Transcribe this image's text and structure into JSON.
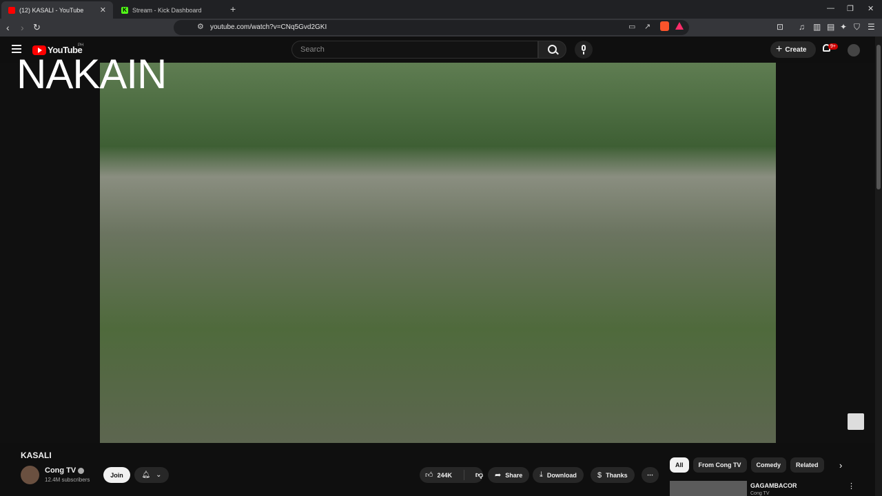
{
  "browser": {
    "tabs": [
      {
        "title": "(12) KASALI - YouTube",
        "active": true
      },
      {
        "title": "Stream - Kick Dashboard",
        "active": false
      }
    ],
    "url": "youtube.com/watch?v=CNq5Gvd2GKI"
  },
  "youtube": {
    "logo_text": "YouTube",
    "country_code": "PH",
    "search_placeholder": "Search",
    "create_label": "Create",
    "notification_count": "9+"
  },
  "video": {
    "overlay_text": "NAKAIN",
    "title": "KASALI"
  },
  "channel": {
    "name": "Cong TV",
    "subscribers": "12.4M subscribers",
    "join_label": "Join"
  },
  "actions": {
    "likes": "244K",
    "share": "Share",
    "download": "Download",
    "thanks": "Thanks"
  },
  "chips": [
    "All",
    "From Cong TV",
    "Comedy",
    "Related"
  ],
  "recommended": [
    {
      "title": "GAGAMBACOR",
      "channel": "Cong TV"
    }
  ],
  "colors": {
    "accent": "#ff0000",
    "kick": "#53fc18",
    "background": "#0f0f0f"
  }
}
